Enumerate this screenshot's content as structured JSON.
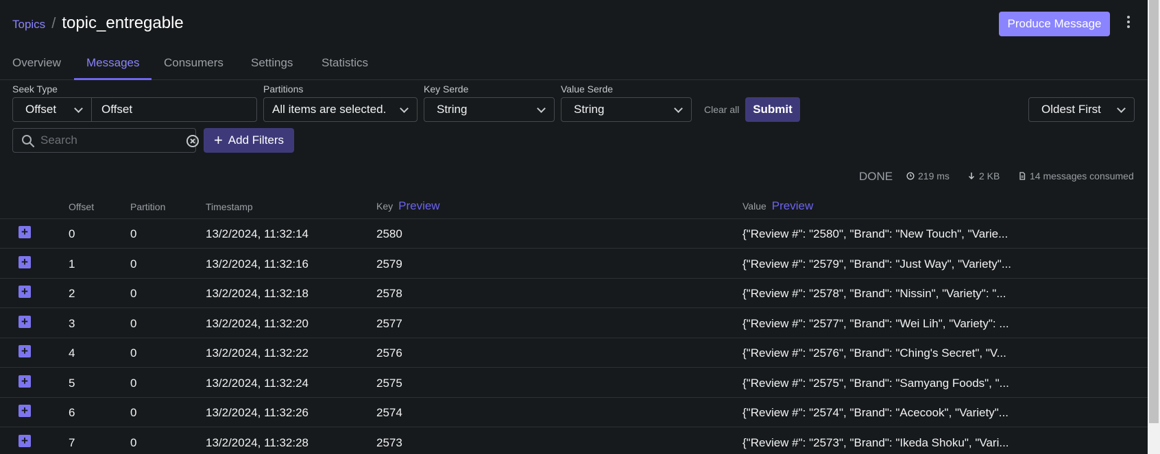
{
  "breadcrumb": {
    "parent": "Topics",
    "separator": "/",
    "title": "topic_entregable"
  },
  "header": {
    "produce_label": "Produce Message"
  },
  "tabs": [
    {
      "label": "Overview"
    },
    {
      "label": "Messages"
    },
    {
      "label": "Consumers"
    },
    {
      "label": "Settings"
    },
    {
      "label": "Statistics"
    }
  ],
  "active_tab": "Messages",
  "filters": {
    "seek_type_label": "Seek Type",
    "seek_type_value": "Offset",
    "seek_value": "Offset",
    "partitions_label": "Partitions",
    "partitions_value": "All items are selected.",
    "key_serde_label": "Key Serde",
    "key_serde_value": "String",
    "value_serde_label": "Value Serde",
    "value_serde_value": "String",
    "clear_all": "Clear all",
    "submit": "Submit",
    "sort_value": "Oldest First",
    "search_placeholder": "Search",
    "add_filters": "Add Filters"
  },
  "status": {
    "state": "DONE",
    "time": "219 ms",
    "size": "2 KB",
    "consumed": "14 messages consumed"
  },
  "table": {
    "columns": {
      "offset": "Offset",
      "partition": "Partition",
      "timestamp": "Timestamp",
      "key": "Key",
      "value": "Value",
      "preview": "Preview"
    },
    "rows": [
      {
        "offset": "0",
        "partition": "0",
        "timestamp": "13/2/2024, 11:32:14",
        "key": "2580",
        "value": "{\"Review #\": \"2580\", \"Brand\": \"New Touch\", \"Varie..."
      },
      {
        "offset": "1",
        "partition": "0",
        "timestamp": "13/2/2024, 11:32:16",
        "key": "2579",
        "value": "{\"Review #\": \"2579\", \"Brand\": \"Just Way\", \"Variety\"..."
      },
      {
        "offset": "2",
        "partition": "0",
        "timestamp": "13/2/2024, 11:32:18",
        "key": "2578",
        "value": "{\"Review #\": \"2578\", \"Brand\": \"Nissin\", \"Variety\": \"..."
      },
      {
        "offset": "3",
        "partition": "0",
        "timestamp": "13/2/2024, 11:32:20",
        "key": "2577",
        "value": "{\"Review #\": \"2577\", \"Brand\": \"Wei Lih\", \"Variety\": ..."
      },
      {
        "offset": "4",
        "partition": "0",
        "timestamp": "13/2/2024, 11:32:22",
        "key": "2576",
        "value": "{\"Review #\": \"2576\", \"Brand\": \"Ching's Secret\", \"V..."
      },
      {
        "offset": "5",
        "partition": "0",
        "timestamp": "13/2/2024, 11:32:24",
        "key": "2575",
        "value": "{\"Review #\": \"2575\", \"Brand\": \"Samyang Foods\", \"..."
      },
      {
        "offset": "6",
        "partition": "0",
        "timestamp": "13/2/2024, 11:32:26",
        "key": "2574",
        "value": "{\"Review #\": \"2574\", \"Brand\": \"Acecook\", \"Variety\"..."
      },
      {
        "offset": "7",
        "partition": "0",
        "timestamp": "13/2/2024, 11:32:28",
        "key": "2573",
        "value": "{\"Review #\": \"2573\", \"Brand\": \"Ikeda Shoku\", \"Vari..."
      }
    ]
  },
  "colors": {
    "background": "#171a1c",
    "accent": "#8a84ff",
    "accent_dark": "#3e3a7a",
    "border": "#2d3135"
  },
  "icons": {
    "search": "search-icon",
    "clear": "clear-circle-icon",
    "plus": "plus-icon",
    "clock": "clock-icon",
    "download": "arrow-down-icon",
    "file": "file-icon",
    "kebab": "kebab-menu-icon",
    "expand": "expand-plus-icon",
    "chevron": "chevron-down-icon"
  }
}
